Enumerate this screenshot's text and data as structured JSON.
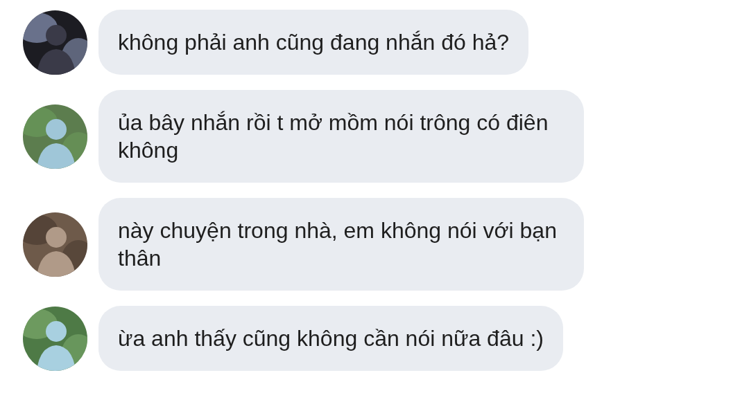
{
  "messages": [
    {
      "text": "không phải anh cũng đang nhắn đó hả?"
    },
    {
      "text": "ủa bây nhắn rồi t mở mồm nói trông có điên không"
    },
    {
      "text": "này chuyện trong nhà, em không nói với bạn thân"
    },
    {
      "text": "ừa anh thấy cũng không cần nói nữa đâu :)"
    }
  ]
}
